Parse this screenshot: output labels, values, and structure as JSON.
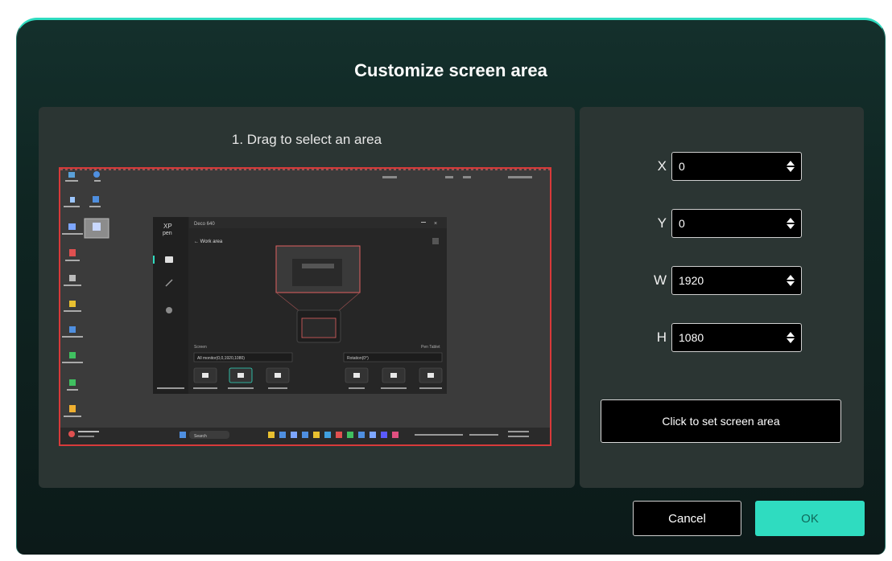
{
  "dialog": {
    "title": "Customize screen area"
  },
  "left_panel": {
    "instruction": "1. Drag to select an area"
  },
  "right_panel": {
    "fields": [
      {
        "label": "X",
        "value": "0"
      },
      {
        "label": "Y",
        "value": "0"
      },
      {
        "label": "W",
        "value": "1920"
      },
      {
        "label": "H",
        "value": "1080"
      }
    ],
    "set_button": "Click to set screen area"
  },
  "footer": {
    "cancel_label": "Cancel",
    "ok_label": "OK"
  },
  "colors": {
    "accent": "#2fdcc0",
    "selection_border": "#d83a3a",
    "panel_bg": "#2b3533"
  },
  "preview_screen": {
    "app_logo": "XP pen",
    "window_title": "Deco 640",
    "work_area_label": "Work area",
    "screen_label": "Screen",
    "pen_tablet_label": "Pen Tablet",
    "monitor_select": "All monitor(0,0,1920,1080)",
    "rotation_select": "Rotation(0°)",
    "screen_options": [
      "Set full screen",
      "Customize screen area",
      "Identify"
    ],
    "tablet_options": [
      "Full area",
      "Customize active area",
      "Proportion"
    ],
    "taskbar_search": "Search",
    "desktop_icons": [
      "This PC",
      "Recycle Bin",
      "Ulysses",
      "Evernote",
      "Notepad",
      "XDP Songs",
      "Logger tablet"
    ]
  }
}
